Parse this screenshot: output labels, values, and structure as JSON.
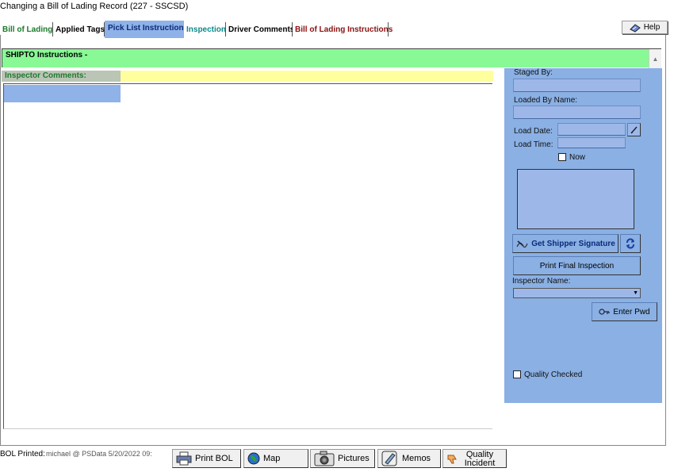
{
  "window": {
    "title": "Changing a Bill of Lading Record  (227 - SSCSD)"
  },
  "tabs": [
    {
      "label": "Bill of Lading",
      "color": "#1a7a2a",
      "active": false
    },
    {
      "label": "Applied Tags",
      "color": "#000000",
      "active": false
    },
    {
      "label": "Pick List Instructions",
      "color": "#0b2a7a",
      "active": true
    },
    {
      "label": "Inspection",
      "color": "#0a8a8a",
      "active": false
    },
    {
      "label": "Driver Comments",
      "color": "#000000",
      "active": false
    },
    {
      "label": "Bill of Lading Instructions",
      "color": "#8b1010",
      "active": false
    }
  ],
  "help": {
    "label": "Help",
    "icon": "help-book-icon"
  },
  "shipto": {
    "label": "SHIPTO Instructions -"
  },
  "inspector_comments": {
    "label": "Inspector Comments:",
    "value": ""
  },
  "panel": {
    "staged_by": {
      "label": "Staged By:",
      "value": ""
    },
    "loaded_by": {
      "label": "Loaded By Name:",
      "value": ""
    },
    "load_date": {
      "label": "Load Date:",
      "value": ""
    },
    "load_time": {
      "label": "Load Time:",
      "value": ""
    },
    "now": {
      "label": "Now",
      "checked": false
    },
    "get_signature": {
      "label": "Get Shipper Signature",
      "icon": "signature-pen-icon"
    },
    "refresh": {
      "icon": "refresh-icon"
    },
    "print_final": {
      "label": "Print Final Inspection"
    },
    "inspector_name": {
      "label": "Inspector Name:",
      "value": ""
    },
    "enter_pwd": {
      "label": "Enter Pwd",
      "icon": "key-icon"
    },
    "quality_checked": {
      "label": "Quality Checked",
      "checked": false
    }
  },
  "footer": {
    "bol_printed_label": "BOL Printed:",
    "bol_printed_value": "michael @ PSData 5/20/2022 09:",
    "buttons": [
      {
        "label": "Print BOL",
        "icon": "printer-icon"
      },
      {
        "label": "Map",
        "icon": "globe-icon"
      },
      {
        "label": "Pictures",
        "icon": "camera-icon"
      },
      {
        "label": "Memos",
        "icon": "memo-icon"
      },
      {
        "label": "Quality Incident",
        "icon": "thumbs-down-icon"
      }
    ]
  },
  "colors": {
    "shipto_bg": "#88f995",
    "inspector_bar": "#ffff9e",
    "panel_bg": "#8ab0e4",
    "tab_active": "#8fb2e8"
  }
}
